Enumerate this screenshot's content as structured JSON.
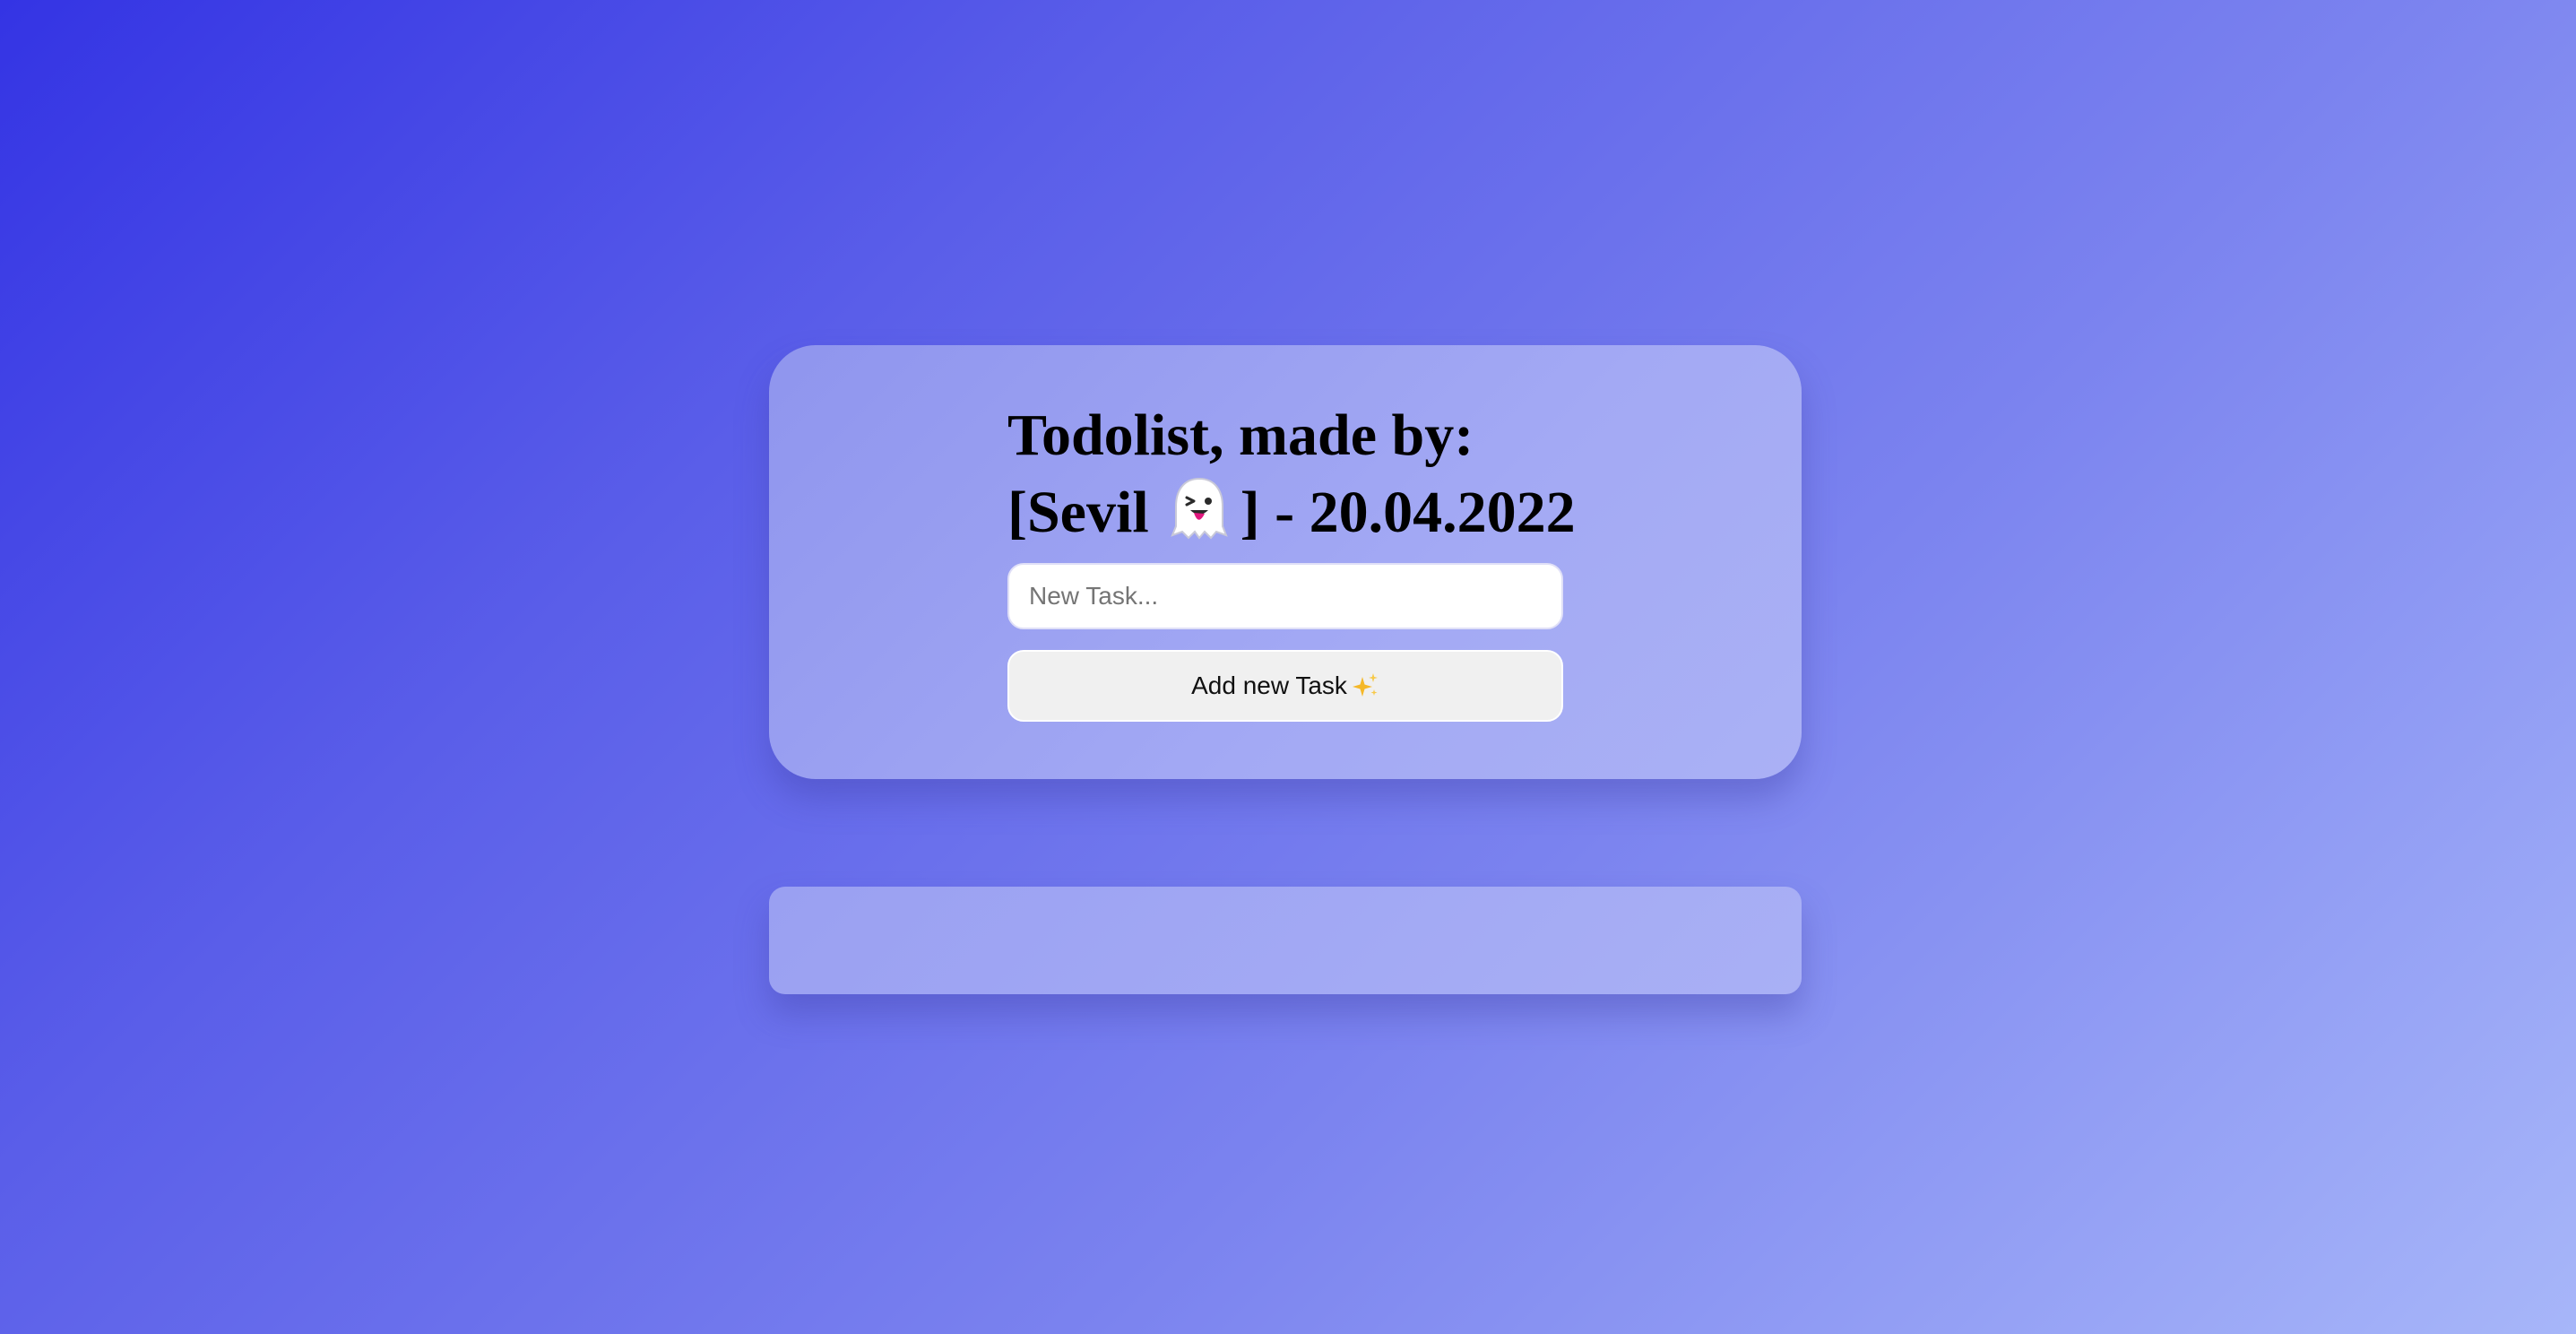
{
  "header": {
    "title_line1": "Todolist, made by:",
    "title_name": "[Sevil",
    "title_suffix": "] - 20.04.2022",
    "ghost_icon": "ghost-emoji-icon"
  },
  "form": {
    "input_value": "",
    "input_placeholder": "New Task...",
    "add_button_label": "Add new Task",
    "add_button_icon": "sparkles-emoji-icon"
  },
  "task_list": {
    "items": []
  },
  "colors": {
    "background_start": "#3434e4",
    "background_end": "#a7b6f9",
    "card": "#9ca2f1",
    "button": "#f0f0f0",
    "input": "#ffffff",
    "sparkle": "#f5b829",
    "ghost_tongue": "#e0177d"
  }
}
